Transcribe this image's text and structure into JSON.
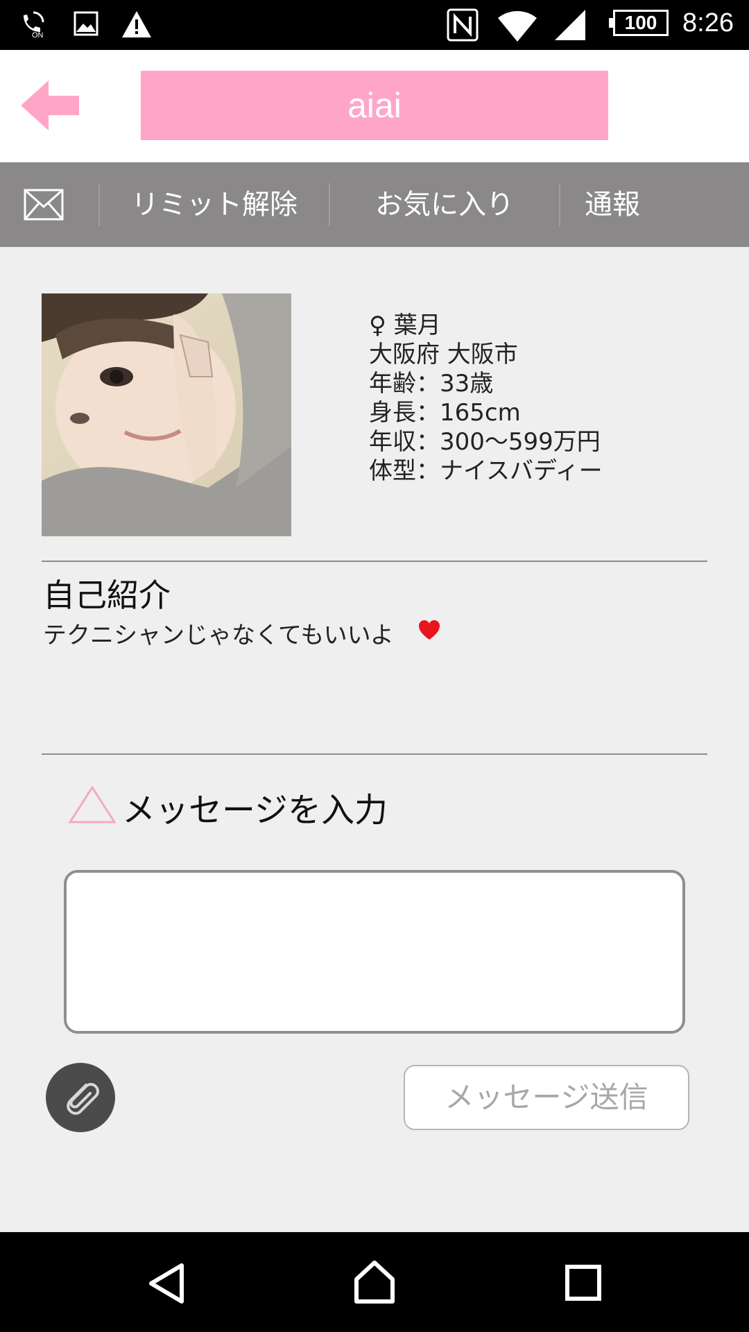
{
  "status_bar": {
    "time": "8:26",
    "battery": "100",
    "icons": [
      "call-on-icon",
      "image-icon",
      "warning-icon",
      "nfc-icon",
      "wifi-icon",
      "signal-icon",
      "battery-icon"
    ]
  },
  "header": {
    "title": "aiai",
    "back_icon": "back-arrow-icon",
    "accent_color": "#ffa6c8"
  },
  "action_bar": {
    "mail_icon": "mail-icon",
    "limit_release": "リミット解除",
    "favorite": "お気に入り",
    "report": "通報",
    "background_color": "#8a8888"
  },
  "profile": {
    "gender_symbol": "♀",
    "name": "葉月",
    "location": "大阪府 大阪市",
    "age": "年齢：33歳",
    "height": "身長：165cm",
    "income": "年収：300〜599万円",
    "body_type": "体型：ナイスバディー"
  },
  "intro": {
    "title": "自己紹介",
    "text": "テクニシャンじゃなくてもいいよ"
  },
  "message": {
    "title": "メッセージを入力",
    "input_value": "",
    "send_label": "メッセージ送信",
    "attach_icon": "paperclip-icon"
  },
  "nav_bar": {
    "icons": [
      "back-nav-icon",
      "home-icon",
      "recents-icon"
    ]
  }
}
